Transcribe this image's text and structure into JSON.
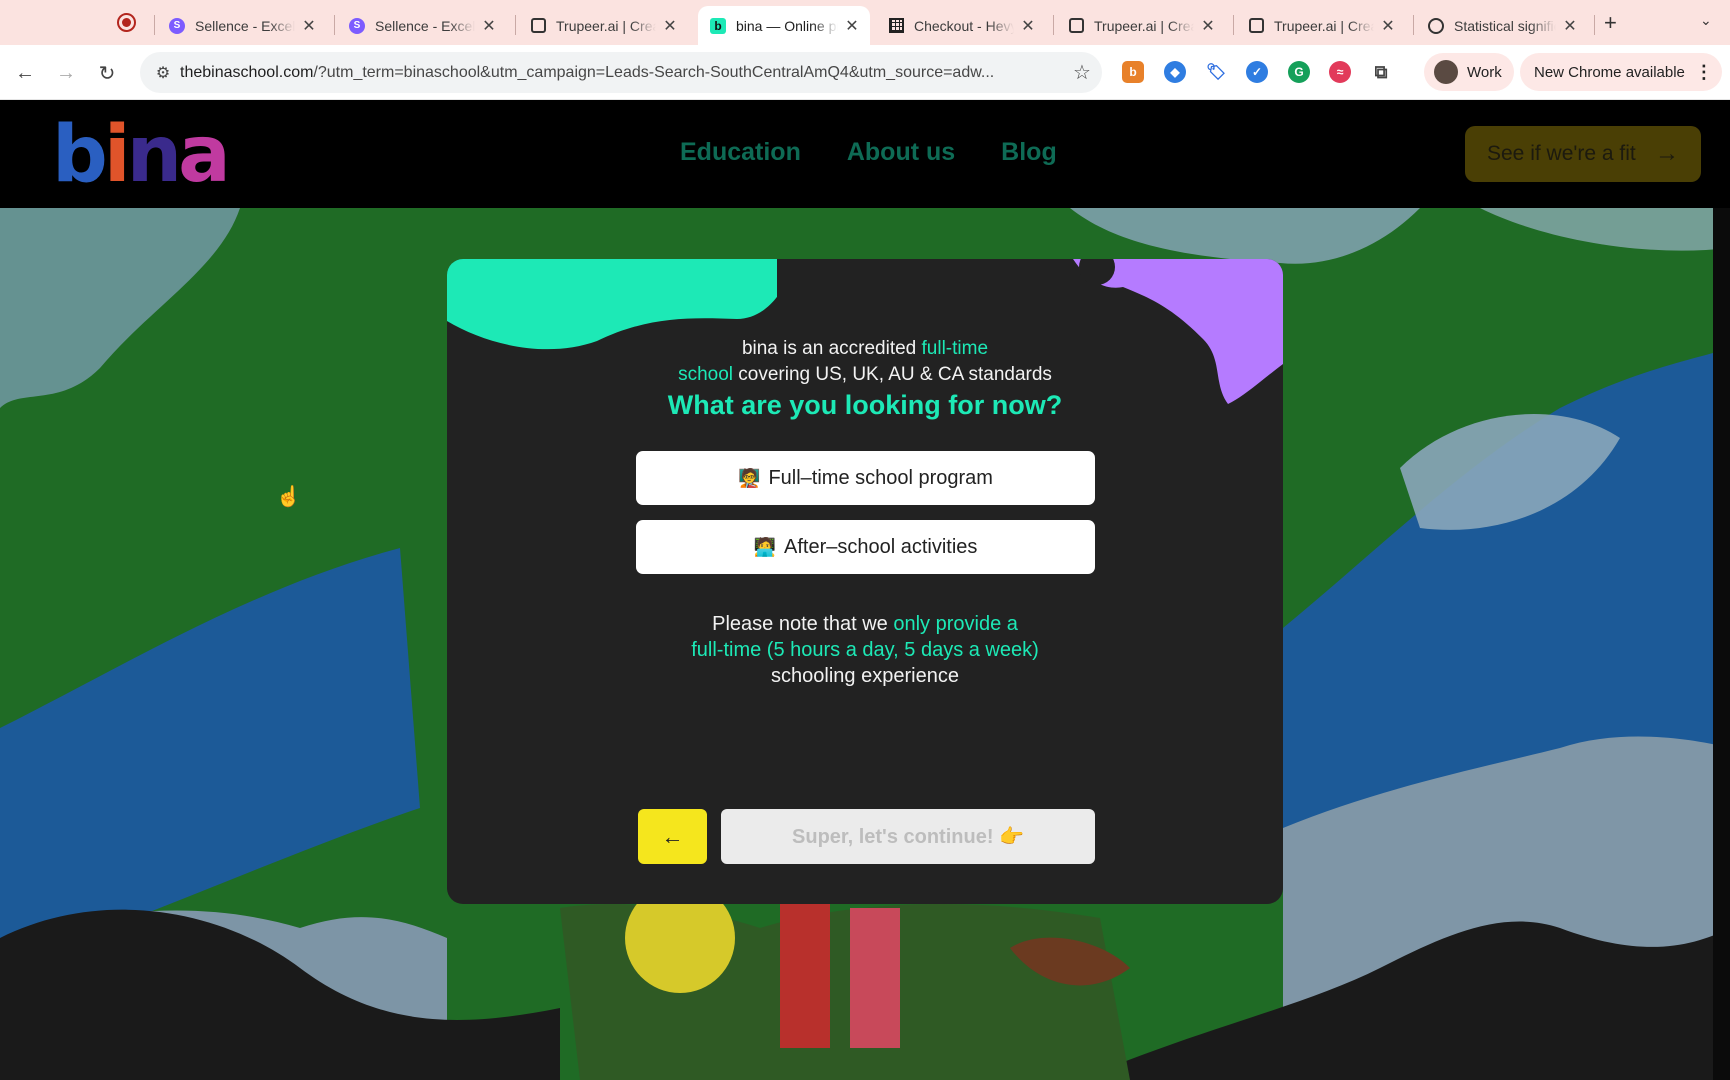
{
  "browser": {
    "tabs": [
      {
        "title": "Sellence - Excel",
        "favicon": "sellence-icon",
        "close": "✕"
      },
      {
        "title": "Sellence - Excel",
        "favicon": "sellence-icon",
        "close": "✕"
      },
      {
        "title": "Trupeer.ai | Create",
        "favicon": "trupeer-icon",
        "close": "✕"
      },
      {
        "title": "bina — Online private",
        "favicon": "bina-icon",
        "close": "✕",
        "active": true
      },
      {
        "title": "Checkout - Hevy",
        "favicon": "spreadsheet-icon",
        "close": "✕"
      },
      {
        "title": "Trupeer.ai | Create",
        "favicon": "trupeer-icon",
        "close": "✕"
      },
      {
        "title": "Trupeer.ai | Create",
        "favicon": "trupeer-icon",
        "close": "✕"
      },
      {
        "title": "Statistical significance",
        "favicon": "openai-icon",
        "close": "✕"
      }
    ],
    "new_tab": "+",
    "url_host": "thebinaschool.com",
    "url_rest": "/?utm_term=binaschool&utm_campaign=Leads-Search-SouthCentralAmQ4&utm_source=adw...",
    "profile_label": "Work",
    "update_label": "New Chrome available",
    "accent": "#fbe3e0"
  },
  "site": {
    "logo": [
      "b",
      "i",
      "n",
      "a"
    ],
    "nav": [
      "Education",
      "About us",
      "Blog"
    ],
    "cta_label": "See if we're a fit",
    "cta_arrow": "→"
  },
  "card": {
    "intro_a": "bina is an accredited ",
    "intro_hl": "full-time",
    "intro_hl2": "school",
    "intro_b": " covering US, UK, AU & CA standards",
    "question": "What are you looking for now?",
    "options": [
      {
        "emoji": "🧑‍🏫",
        "label": "Full–time school program"
      },
      {
        "emoji": "🧑‍💻",
        "label": "After–school activities"
      }
    ],
    "note_a": "Please note that we ",
    "note_hl": "only provide a",
    "note_hl2": "full-time (5 hours a day, 5 days a week)",
    "note_b": "schooling experience",
    "back_arrow": "←",
    "continue_label": "Super, let's continue! 👉",
    "colors": {
      "teal": "#1de9b6",
      "purple": "#b57bff",
      "yellow": "#f5e61d"
    }
  }
}
